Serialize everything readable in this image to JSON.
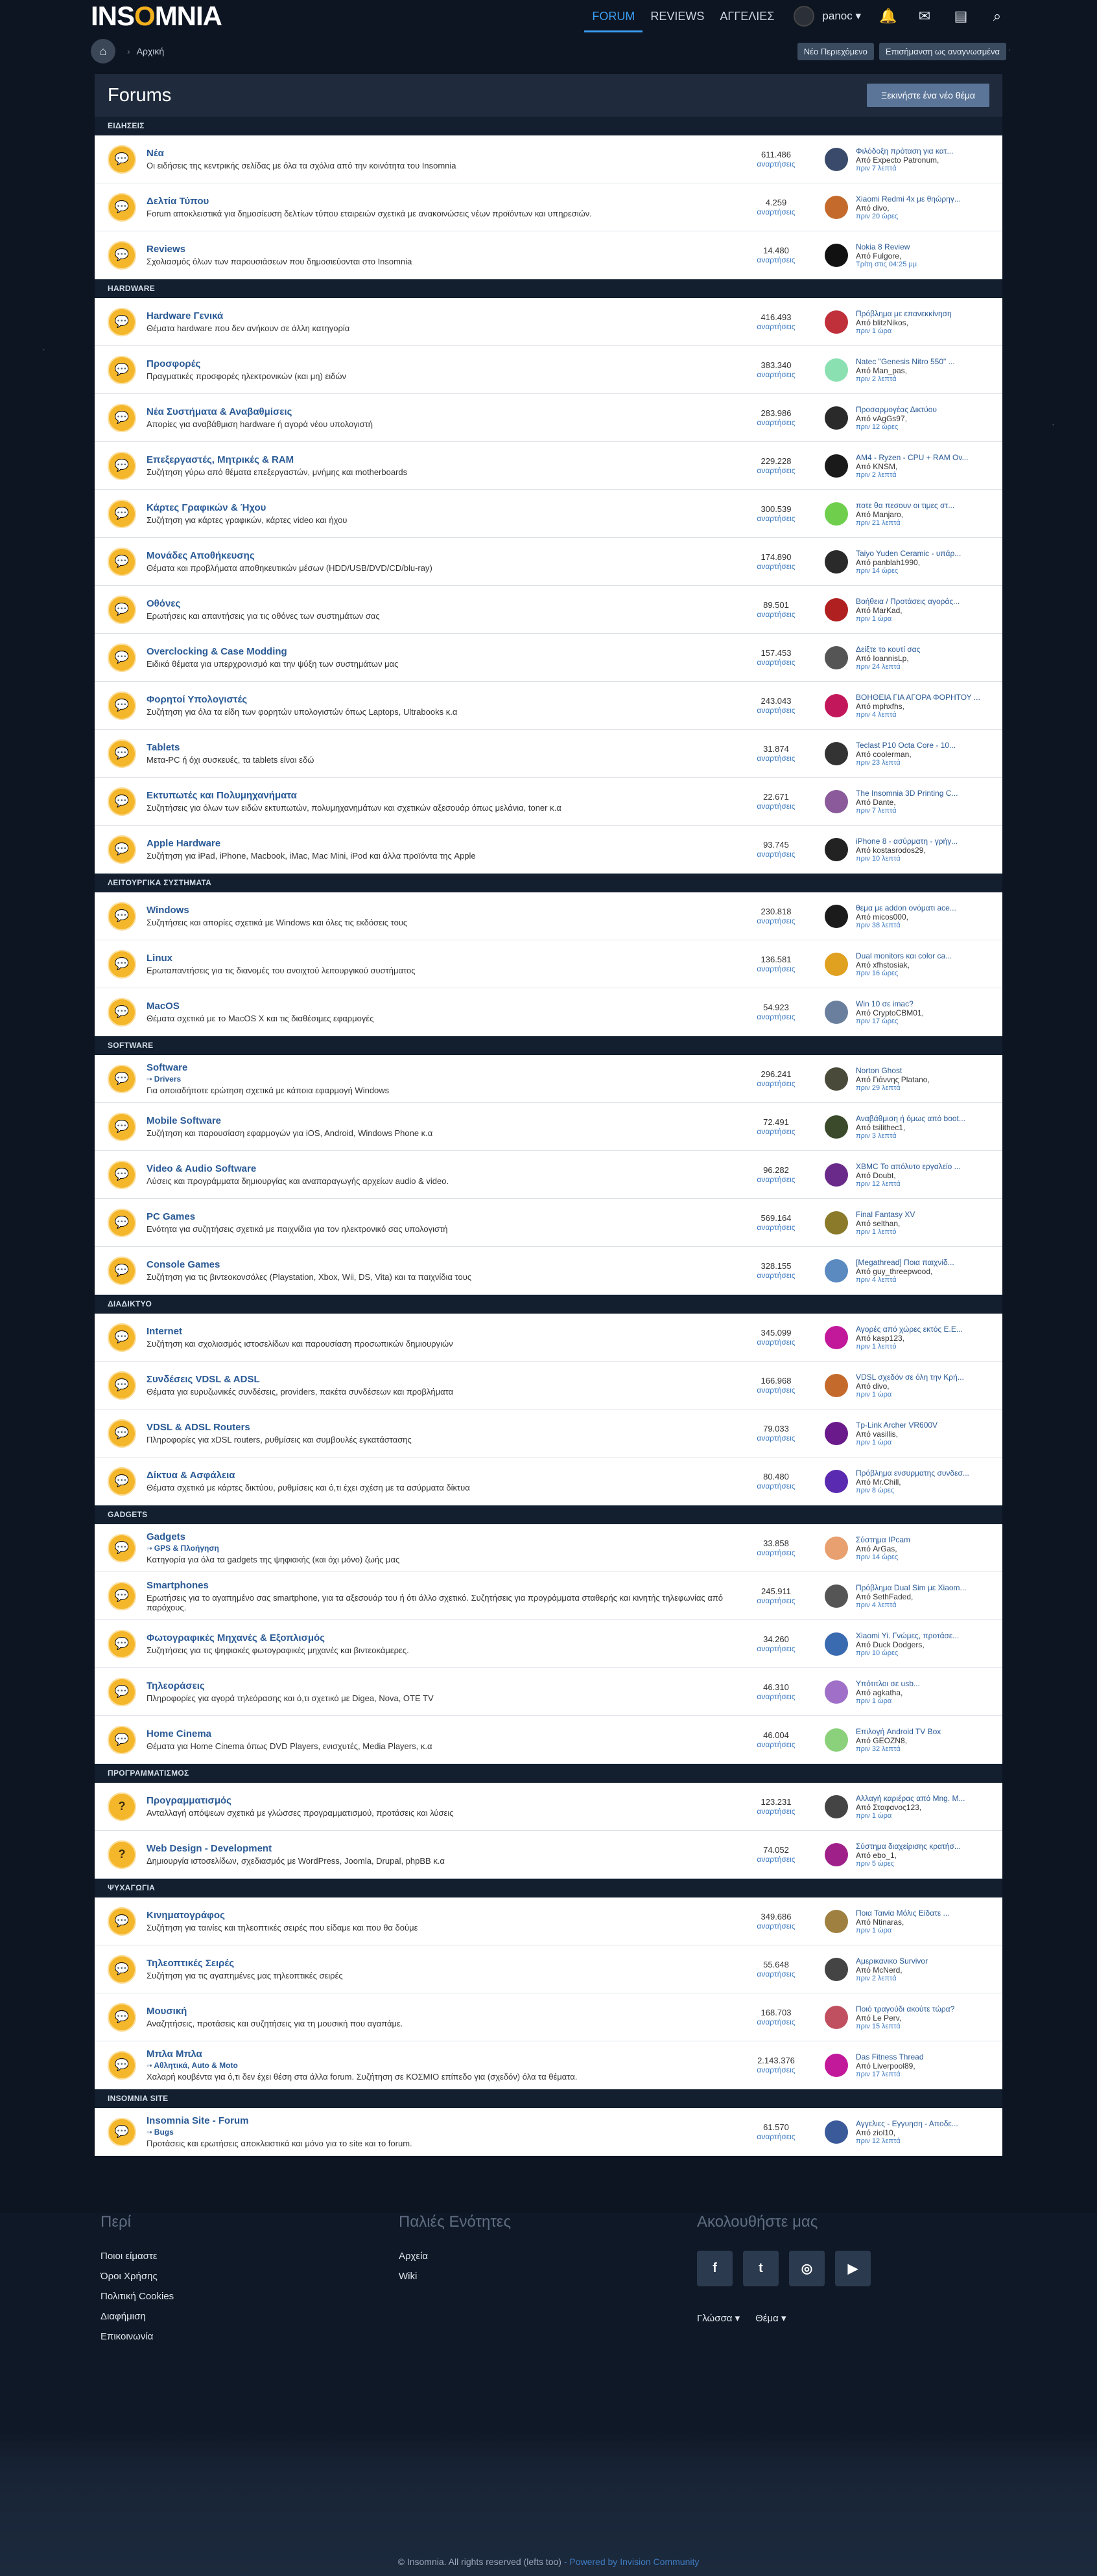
{
  "header": {
    "logo": "INSOMNIA",
    "nav": [
      "FORUM",
      "REVIEWS",
      "ΑΓΓΕΛΙΕΣ"
    ],
    "user": "panoc ▾"
  },
  "crumb": {
    "home": "Αρχική",
    "new_content": "Νέο Περιεχόμενο",
    "mark_read": "Επισήμανση ως αναγνωσμένα"
  },
  "page": {
    "title": "Forums",
    "new_topic": "Ξεκινήστε ένα νέο θέμα"
  },
  "stat_label": "αναρτήσεις",
  "categories": [
    {
      "name": "ΕΙΔΗΣΕΙΣ",
      "forums": [
        {
          "name": "Νέα",
          "desc": "Οι ειδήσεις της κεντρικής σελίδας με όλα τα σχόλια από την κοινότητα του Insomnia",
          "count": "611.486",
          "lt": "Φιλόδοξη πρόταση για κατ...",
          "lb": "Από Expecto Patronum,",
          "lti": "πριν 7 λεπτά",
          "ac": "#3a4a6b"
        },
        {
          "name": "Δελτία Τύπου",
          "desc": "Forum αποκλειστικά για δημοσίευση δελτίων τύπου εταιρειών σχετικά με ανακοινώσεις νέων προϊόντων και υπηρεσιών.",
          "count": "4.259",
          "lt": "Xiaomi Redmi 4x με θηώρηγ...",
          "lb": "Από divo,",
          "lti": "πριν 20 ώρες",
          "ac": "#c46a2c"
        },
        {
          "name": "Reviews",
          "desc": "Σχολιασμός όλων των παρουσιάσεων που δημοσιεύονται στο Insomnia",
          "count": "14.480",
          "lt": "Nokia 8 Review",
          "lb": "Από Fulgore,",
          "lti": "Τρίτη στις 04:25 μμ",
          "ac": "#111"
        }
      ]
    },
    {
      "name": "HARDWARE",
      "forums": [
        {
          "name": "Hardware Γενικά",
          "desc": "Θέματα hardware που δεν ανήκουν σε άλλη κατηγορία",
          "count": "416.493",
          "lt": "Πρόβλημα με επανεκκίνηση",
          "lb": "Από blitzNikos,",
          "lti": "πριν 1 ώρα",
          "ac": "#c0303a"
        },
        {
          "name": "Προσφορές",
          "desc": "Πραγματικές προσφορές ηλεκτρονικών (και μη) ειδών",
          "count": "383.340",
          "lt": "Natec \"Genesis Nitro 550\" ...",
          "lb": "Από Man_pas,",
          "lti": "πριν 2 λεπτά",
          "ac": "#8be0b2"
        },
        {
          "name": "Νέα Συστήματα & Αναβαθμίσεις",
          "desc": "Απορίες για αναβάθμιση hardware ή αγορά νέου υπολογιστή",
          "count": "283.986",
          "lt": "Προσαρμογέας Δικτύου",
          "lb": "Από vAgGs97,",
          "lti": "πριν 12 ώρες",
          "ac": "#2a2a2a"
        },
        {
          "name": "Επεξεργαστές, Μητρικές & RAM",
          "desc": "Συζήτηση γύρω από θέματα επεξεργαστών, μνήμης και motherboards",
          "count": "229.228",
          "lt": "AM4 - Ryzen - CPU + RAM Ov...",
          "lb": "Από KNSM,",
          "lti": "πριν 2 λεπτά",
          "ac": "#1a1a1a"
        },
        {
          "name": "Κάρτες Γραφικών & Ήχου",
          "desc": "Συζήτηση για κάρτες γραφικών, κάρτες video και ήχου",
          "count": "300.539",
          "lt": "ποτε θα πεσουν οι τιμες στ...",
          "lb": "Από Manjaro,",
          "lti": "πριν 21 λεπτά",
          "ac": "#6fcf4d"
        },
        {
          "name": "Μονάδες Αποθήκευσης",
          "desc": "Θέματα και προβλήματα αποθηκευτικών μέσων (HDD/USB/DVD/CD/blu-ray)",
          "count": "174.890",
          "lt": "Taiyo Yuden Ceramic - υπάρ...",
          "lb": "Από panblah1990,",
          "lti": "πριν 14 ώρες",
          "ac": "#2a2a2a"
        },
        {
          "name": "Οθόνες",
          "desc": "Ερωτήσεις και απαντήσεις για τις οθόνες των συστημάτων σας",
          "count": "89.501",
          "lt": "Βοήθεια / Προτάσεις αγοράς...",
          "lb": "Από MarKad,",
          "lti": "πριν 1 ώρα",
          "ac": "#b02020"
        },
        {
          "name": "Overclocking & Case Modding",
          "desc": "Ειδικά θέματα για υπερχρονισμό και την ψύξη των συστημάτων μας",
          "count": "157.453",
          "lt": "Δείξτε το κουτί σας",
          "lb": "Από IoannisLp,",
          "lti": "πριν 24 λεπτά",
          "ac": "#555"
        },
        {
          "name": "Φορητοί Υπολογιστές",
          "desc": "Συζήτηση για όλα τα είδη των φορητών υπολογιστών όπως Laptops, Ultrabooks κ.α",
          "count": "243.043",
          "lt": "ΒΟΗΘΕΙΑ ΓΙΑ ΑΓΟΡΑ ΦΟΡΗΤΟΥ ...",
          "lb": "Από mphxfhs,",
          "lti": "πριν 4 λεπτά",
          "ac": "#c2185b"
        },
        {
          "name": "Tablets",
          "desc": "Μετα-PC ή όχι συσκευές, τα tablets είναι εδώ",
          "count": "31.874",
          "lt": "Teclast P10 Octa Core - 10...",
          "lb": "Από coolerman,",
          "lti": "πριν 23 λεπτά",
          "ac": "#333"
        },
        {
          "name": "Εκτυπωτές και Πολυμηχανήματα",
          "desc": "Συζητήσεις για όλων των ειδών εκτυπωτών, πολυμηχανημάτων και σχετικών αξεσουάρ όπως μελάνια, toner κ.α",
          "count": "22.671",
          "lt": "The Insomnia 3D Printing C...",
          "lb": "Από Dante,",
          "lti": "πριν 7 λεπτά",
          "ac": "#8a5a9a"
        },
        {
          "name": "Apple Hardware",
          "desc": "Συζήτηση για iPad, iPhone, Macbook, iMac, Mac Mini, iPod και άλλα προϊόντα της Apple",
          "count": "93.745",
          "lt": "iPhone 8 - ασύρματη - γρήγ...",
          "lb": "Από kostasrodos29,",
          "lti": "πριν 10 λεπτά",
          "ac": "#222"
        }
      ]
    },
    {
      "name": "ΛΕΙΤΟΥΡΓΙΚΑ ΣΥΣΤΗΜΑΤΑ",
      "forums": [
        {
          "name": "Windows",
          "desc": "Συζητήσεις και απορίες σχετικά με Windows και όλες τις εκδόσεις τους",
          "count": "230.818",
          "lt": "θεμα με addon ονόματι ace...",
          "lb": "Από micos000,",
          "lti": "πριν 38 λεπτά",
          "ac": "#1b1b1b"
        },
        {
          "name": "Linux",
          "desc": "Ερωταπαντήσεις για τις διανομές του ανοιχτού λειτουργικού συστήματος",
          "count": "136.581",
          "lt": "Dual monitors και color ca...",
          "lb": "Από xfhstosiak,",
          "lti": "πριν 16 ώρες",
          "ac": "#e0a020"
        },
        {
          "name": "MacOS",
          "desc": "Θέματα σχετικά με το MacOS X και τις διαθέσιμες εφαρμογές",
          "count": "54.923",
          "lt": "Win 10 σε imac?",
          "lb": "Από CryptoCBM01,",
          "lti": "πριν 17 ώρες",
          "ac": "#6a7f9e"
        }
      ]
    },
    {
      "name": "SOFTWARE",
      "forums": [
        {
          "name": "Software",
          "sub": "Drivers",
          "desc": "Για οποιαδήποτε ερώτηση σχετικά με κάποια εφαρμογή Windows",
          "count": "296.241",
          "lt": "Norton Ghost",
          "lb": "Από Γιάννης Platano,",
          "lti": "πριν 29 λεπτά",
          "ac": "#4a4a3a"
        },
        {
          "name": "Mobile Software",
          "desc": "Συζήτηση και παρουσίαση εφαρμογών για iOS, Android, Windows Phone κ.α",
          "count": "72.491",
          "lt": "Αναβάθμιση ή όμως από boot...",
          "lb": "Από tsilithec1,",
          "lti": "πριν 3 λεπτά",
          "ac": "#3a4a2a"
        },
        {
          "name": "Video & Audio Software",
          "desc": "Λύσεις και προγράμματα δημιουργίας και αναπαραγωγής αρχείων audio & video.",
          "count": "96.282",
          "lt": "XBMC Το απόλυτο εργαλείο ...",
          "lb": "Από Doubt,",
          "lti": "πριν 12 λεπτά",
          "ac": "#6a2a8a"
        },
        {
          "name": "PC Games",
          "desc": "Ενότητα για συζητήσεις σχετικά με παιχνίδια για τον ηλεκτρονικό σας υπολογιστή",
          "count": "569.164",
          "lt": "Final Fantasy XV",
          "lb": "Από selthan,",
          "lti": "πριν 1 λεπτό",
          "ac": "#8a7a2a"
        },
        {
          "name": "Console Games",
          "desc": "Συζήτηση για τις βιντεοκονσόλες (Playstation, Xbox, Wii, DS, Vita) και τα παιχνίδια τους",
          "count": "328.155",
          "lt": "[Megathread] Ποια παιχνίδ...",
          "lb": "Από guy_threepwood,",
          "lti": "πριν 4 λεπτά",
          "ac": "#5a8ac0"
        }
      ]
    },
    {
      "name": "ΔΙΑΔΙΚΤΥΟ",
      "forums": [
        {
          "name": "Internet",
          "desc": "Συζήτηση και σχολιασμός ιστοσελίδων και παρουσίαση προσωπικών δημιουργιών",
          "count": "345.099",
          "lt": "Αγορές από χώρες εκτός Ε.Ε...",
          "lb": "Από kasp123,",
          "lti": "πριν 1 λεπτό",
          "ac": "#c2189a"
        },
        {
          "name": "Συνδέσεις VDSL & ADSL",
          "desc": "Θέματα για ευρυζωνικές συνδέσεις, providers, πακέτα συνδέσεων και προβλήματα",
          "count": "166.968",
          "lt": "VDSL σχεδόν σε όλη την Κρή...",
          "lb": "Από divo,",
          "lti": "πριν 1 ώρα",
          "ac": "#c46a2c"
        },
        {
          "name": "VDSL & ADSL Routers",
          "desc": "Πληροφορίες για xDSL routers, ρυθμίσεις και συμβουλές εγκατάστασης",
          "count": "79.033",
          "lt": "Tp-Link Archer VR600V",
          "lb": "Από vasillis,",
          "lti": "πριν 1 ώρα",
          "ac": "#6a1a8a"
        },
        {
          "name": "Δίκτυα & Ασφάλεια",
          "desc": "Θέματα σχετικά με κάρτες δικτύου, ρυθμίσεις και ό,τι έχει σχέση με τα ασύρματα δίκτυα",
          "count": "80.480",
          "lt": "Πρόβλημα ενσυρματης συνδεσ...",
          "lb": "Από Mr.Chill,",
          "lti": "πριν 8 ώρες",
          "ac": "#5a2ab0"
        }
      ]
    },
    {
      "name": "GADGETS",
      "forums": [
        {
          "name": "Gadgets",
          "sub": "GPS & Πλοήγηση",
          "desc": "Κατηγορία για όλα τα gadgets της ψηφιακής (και όχι μόνο) ζωής μας",
          "count": "33.858",
          "lt": "Σύστημα IPcam",
          "lb": "Από ArGas,",
          "lti": "πριν 14 ώρες",
          "ac": "#e8a070"
        },
        {
          "name": "Smartphones",
          "desc": "Ερωτήσεις για το αγαπημένο σας smartphone, για τα αξεσουάρ του ή ότι άλλο σχετικό. Συζητήσεις για προγράμματα σταθερής και κινητής τηλεφωνίας από παρόχους.",
          "count": "245.911",
          "lt": "Πρόβλημα Dual Sim με Xiaom...",
          "lb": "Από SethFaded,",
          "lti": "πριν 4 λεπτά",
          "ac": "#555"
        },
        {
          "name": "Φωτογραφικές Μηχανές & Εξοπλισμός",
          "desc": "Συζητήσεις για τις ψηφιακές φωτογραφικές μηχανές και βιντεοκάμερες.",
          "count": "34.260",
          "lt": "Xiaomi Yi. Γνώμες, προτάσε...",
          "lb": "Από Duck Dodgers,",
          "lti": "πριν 10 ώρες",
          "ac": "#3a6ab0"
        },
        {
          "name": "Τηλεοράσεις",
          "desc": "Πληροφορίες για αγορά τηλεόρασης και ό,τι σχετικό με Digea, Nova, OTE TV",
          "count": "46.310",
          "lt": "Υπότιτλοι σε usb...",
          "lb": "Από agkatha,",
          "lti": "πριν 1 ώρα",
          "ac": "#a070c8"
        },
        {
          "name": "Home Cinema",
          "desc": "Θέματα για Home Cinema όπως DVD Players, ενισχυτές, Media Players, κ.α",
          "count": "46.004",
          "lt": "Επιλογή Android TV Box",
          "lb": "Από GEOZN8,",
          "lti": "πριν 32 λεπτά",
          "ac": "#8bd07a"
        }
      ]
    },
    {
      "name": "ΠΡΟΓΡΑΜΜΑΤΙΣΜΟΣ",
      "forums": [
        {
          "name": "Προγραμματισμός",
          "desc": "Ανταλλαγή απόψεων σχετικά με γλώσσες προγραμματισμού, προτάσεις και λύσεις",
          "count": "123.231",
          "lt": "Αλλαγή καριέρας από Mng. M...",
          "lb": "Από Σταφανος123,",
          "lti": "πριν 1 ώρα",
          "ac": "#444",
          "icon": "?"
        },
        {
          "name": "Web Design - Development",
          "desc": "Δημιουργία ιστοσελίδων, σχεδιασμός με WordPress, Joomla, Drupal, phpBB κ.α",
          "count": "74.052",
          "lt": "Σύστημα διαχείρισης κρατήσ...",
          "lb": "Από ebo_1,",
          "lti": "πριν 5 ώρες",
          "ac": "#a0208a",
          "icon": "?"
        }
      ]
    },
    {
      "name": "ΨΥΧΑΓΩΓΙΑ",
      "forums": [
        {
          "name": "Κινηματογράφος",
          "desc": "Συζήτηση για ταινίες και τηλεοπτικές σειρές που είδαμε και που θα δούμε",
          "count": "349.686",
          "lt": "Ποια Ταινία Μόλις Είδατε ...",
          "lb": "Από Ntinaras,",
          "lti": "πριν 1 ώρα",
          "ac": "#a08040"
        },
        {
          "name": "Τηλεοπτικές Σειρές",
          "desc": "Συζήτηση για τις αγαπημένες μας τηλεοπτικές σειρές",
          "count": "55.648",
          "lt": "Αμερικανικο Survivor",
          "lb": "Από McNerd,",
          "lti": "πριν 2 λεπτά",
          "ac": "#444"
        },
        {
          "name": "Μουσική",
          "desc": "Αναζητήσεις, προτάσεις και συζητήσεις για τη μουσική που αγαπάμε.",
          "count": "168.703",
          "lt": "Ποιό τραγούδι ακούτε τώρα?",
          "lb": "Από Le Perv,",
          "lti": "πριν 15 λεπτά",
          "ac": "#c05060"
        },
        {
          "name": "Μπλα Μπλα",
          "sub": "Αθλητικά,  Auto & Moto",
          "desc": "Χαλαρή κουβέντα για ό,τι δεν έχει θέση στα άλλα forum. Συζήτηση σε ΚΟΣΜΙΟ επίπεδο για (σχεδόν) όλα τα θέματα.",
          "count": "2.143.376",
          "lt": "Das Fitness Thread",
          "lb": "Από Liverpool89,",
          "lti": "πριν 17 λεπτά",
          "ac": "#c2189a"
        }
      ]
    },
    {
      "name": "INSOMNIA SITE",
      "forums": [
        {
          "name": "Insomnia Site - Forum",
          "sub": "Bugs",
          "desc": "Προτάσεις και ερωτήσεις αποκλειστικά και μόνο για το site και το forum.",
          "count": "61.570",
          "lt": "Αγγελιες - Εγγυηση - Αποδε...",
          "lb": "Από ziol10,",
          "lti": "πριν 12 λεπτά",
          "ac": "#3a5a9a"
        }
      ]
    }
  ],
  "footer": {
    "about": "Περί",
    "about_links": [
      "Ποιοι είμαστε",
      "Όροι Χρήσης",
      "Πολιτική Cookies",
      "Διαφήμιση",
      "Επικοινωνία"
    ],
    "old": "Παλιές Ενότητες",
    "old_links": [
      "Αρχεία",
      "Wiki"
    ],
    "follow": "Ακολουθήστε μας",
    "social": [
      "f",
      "t",
      "◎",
      "▶"
    ],
    "lang": "Γλώσσα ▾",
    "theme": "Θέμα ▾",
    "copy": "© Insomnia. All rights reserved (lefts too)",
    "powered": " - Powered by Invision Community"
  }
}
